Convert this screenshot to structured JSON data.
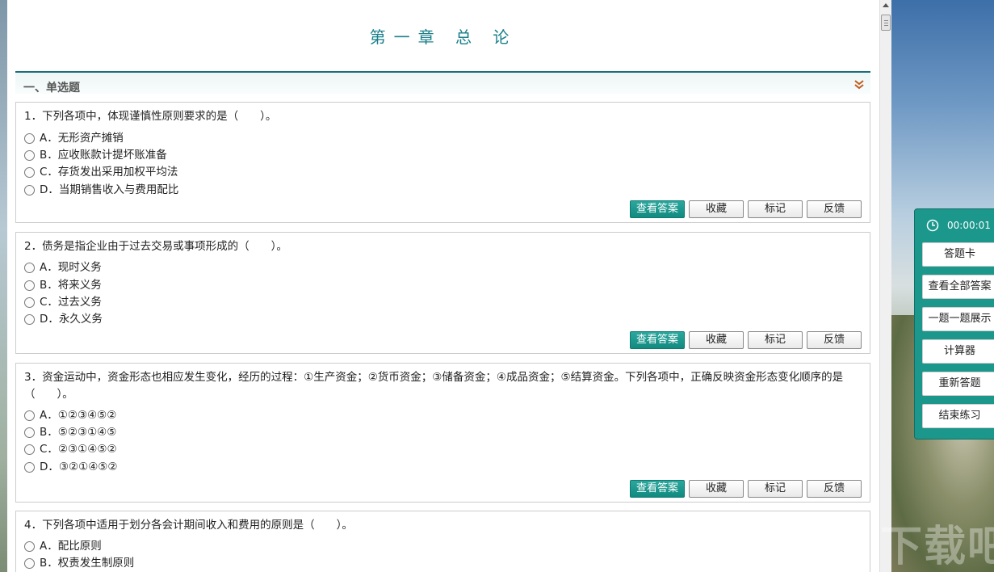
{
  "page": {
    "title": "第一章 总 论",
    "section_title": "一、单选题"
  },
  "questions": [
    {
      "stem": "1．下列各项中，体现谨慎性原则要求的是（　　）。",
      "options": [
        "A．无形资产摊销",
        "B．应收账款计提坏账准备",
        "C．存货发出采用加权平均法",
        "D．当期销售收入与费用配比"
      ]
    },
    {
      "stem": "2．债务是指企业由于过去交易或事项形成的（　　）。",
      "options": [
        "A．现时义务",
        "B．将来义务",
        "C．过去义务",
        "D．永久义务"
      ]
    },
    {
      "stem": "3．资金运动中，资金形态也相应发生变化，经历的过程：①生产资金；②货币资金；③储备资金；④成品资金；⑤结算资金。下列各项中，正确反映资金形态变化顺序的是（　　）。",
      "options": [
        "A．①②③④⑤②",
        "B．⑤②③①④⑤",
        "C．②③①④⑤②",
        "D．③②①④⑤②"
      ]
    },
    {
      "stem": "4．下列各项中适用于划分各会计期间收入和费用的原则是（　　）。",
      "options": [
        "A．配比原则",
        "B．权责发生制原则"
      ]
    }
  ],
  "question_buttons": {
    "view_answer": "查看答案",
    "favorite": "收藏",
    "mark": "标记",
    "feedback": "反馈"
  },
  "panel": {
    "timer": "00:00:01",
    "buttons": [
      "答题卡",
      "查看全部答案",
      "一题一题展示",
      "计算器",
      "重新答题",
      "结束练习"
    ]
  },
  "watermark": "下载吧",
  "colors": {
    "accent": "#1b978c",
    "title": "#1a7f8a",
    "primary_button": "#128a80"
  }
}
